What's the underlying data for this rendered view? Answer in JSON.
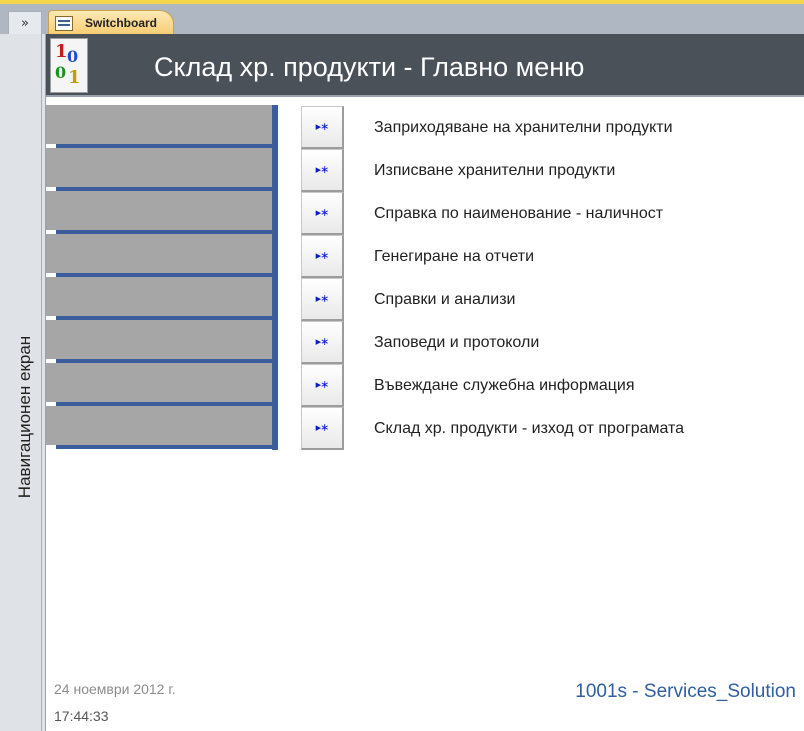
{
  "nav_toggle": "»",
  "tab": {
    "label": "Switchboard"
  },
  "navpane": {
    "label": "Навигационен екран"
  },
  "logo": {
    "text": [
      "1",
      "0",
      "0",
      "1"
    ]
  },
  "header": {
    "title": "Склад хр. продукти - Главно меню"
  },
  "menu": {
    "button_icon": "▸∗",
    "items": [
      {
        "label": "Заприходяване на хранителни продукти"
      },
      {
        "label": "Изписване хранителни продукти"
      },
      {
        "label": "Справка по наименование -  наличност"
      },
      {
        "label": "Генегиране на отчети"
      },
      {
        "label": "Справки и анализи"
      },
      {
        "label": "Заповеди и протоколи"
      },
      {
        "label": "Въвеждане служебна информация"
      },
      {
        "label": "Склад хр. продукти - изход от програмата"
      }
    ]
  },
  "footer": {
    "date": "24 ноември 2012 г.",
    "time": "17:44:33",
    "company": "1001s - Services_Solution"
  }
}
